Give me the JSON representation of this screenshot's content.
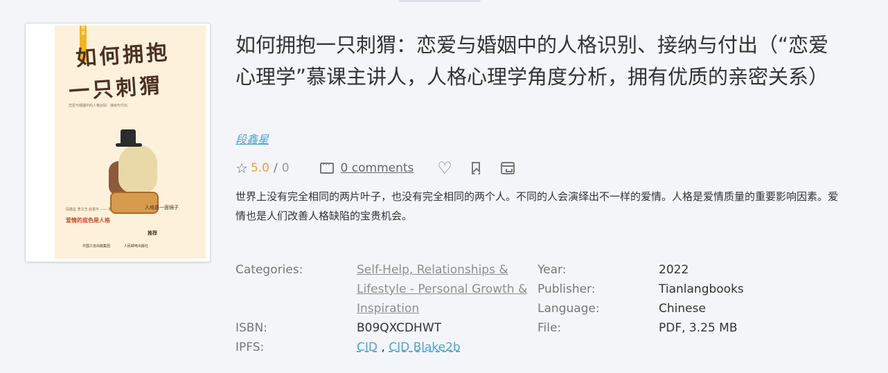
{
  "book": {
    "title": "如何拥抱一只刺猬：恋爱与婚姻中的人格识别、接纳与付出（“恋爱心理学”慕课主讲人，人格心理学角度分析，拥有优质的亲密关系）",
    "author": "段鑫星",
    "rating": "5.0",
    "rating_count": "0",
    "comments_label": "0 comments",
    "description": "世界上没有完全相同的两片叶子，也没有完全相同的两个人。不同的人会演绎出不一样的爱情。人格是爱情质量的重要影响因素。爱情也是人们改善人格缺陷的宝贵机会。"
  },
  "cover": {
    "badge": "悦读",
    "title_line1": "如何拥抱",
    "title_line2": "一只刺猬",
    "subtitle": "恋爱与婚姻中的人格识别、接纳与付出",
    "authors": "段鑫星  李文玉  赵富平 —— 著",
    "tagline": "爱情的底色是人格",
    "side_text": "人格是一面镜子",
    "recommend": "推荐",
    "publisher_a": "中国工信出版集团",
    "publisher_b": "人民邮电出版社"
  },
  "details": {
    "categories_label": "Categories:",
    "categories_value": "Self-Help, Relationships & Lifestyle - Personal Growth & Inspiration",
    "isbn_label": "ISBN:",
    "isbn_value": "B09QXCDHWT",
    "ipfs_label": "IPFS:",
    "ipfs_cid": "CID",
    "ipfs_sep": ",",
    "ipfs_blake": "CID Blake2b",
    "year_label": "Year:",
    "year_value": "2022",
    "publisher_label": "Publisher:",
    "publisher_value": "Tianlangbooks",
    "language_label": "Language:",
    "language_value": "Chinese",
    "file_label": "File:",
    "file_value": "PDF, 3.25 MB"
  },
  "colors": {
    "link_blue": "#4ea3c8",
    "rating_orange": "#e6a23c",
    "background": "#f4f5f9"
  },
  "icons": [
    "star-icon",
    "comment-icon",
    "heart-icon",
    "bookmark-icon",
    "archive-icon"
  ]
}
